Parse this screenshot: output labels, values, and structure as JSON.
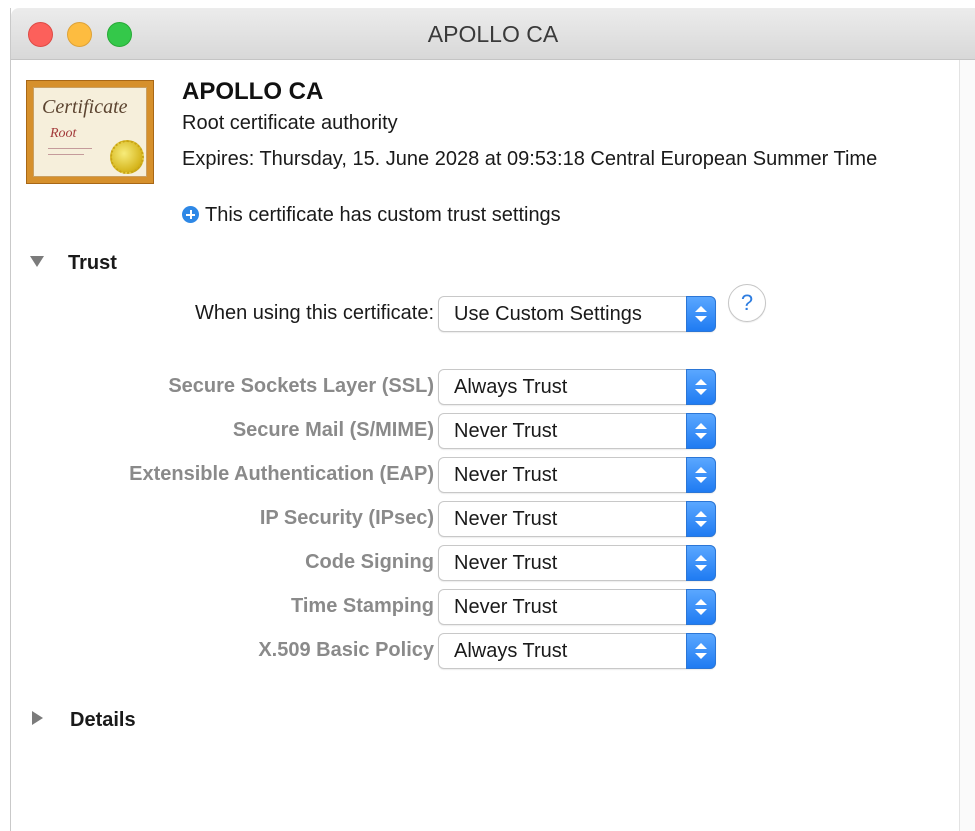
{
  "window": {
    "title": "APOLLO CA"
  },
  "certificate": {
    "icon": "certificate-icon",
    "icon_script": "Certificate",
    "icon_root": "Root",
    "name": "APOLLO CA",
    "kind": "Root certificate authority",
    "expires": "Expires: Thursday, 15. June 2028 at 09:53:18 Central European Summer Time",
    "custom_note": "This certificate has custom trust settings"
  },
  "trust": {
    "section_label": "Trust",
    "expanded": true,
    "when_using_label": "When using this certificate:",
    "when_using_value": "Use Custom Settings",
    "help_label": "?",
    "rows": [
      {
        "label": "Secure Sockets Layer (SSL)",
        "value": "Always Trust"
      },
      {
        "label": "Secure Mail (S/MIME)",
        "value": "Never Trust"
      },
      {
        "label": "Extensible Authentication (EAP)",
        "value": "Never Trust"
      },
      {
        "label": "IP Security (IPsec)",
        "value": "Never Trust"
      },
      {
        "label": "Code Signing",
        "value": "Never Trust"
      },
      {
        "label": "Time Stamping",
        "value": "Never Trust"
      },
      {
        "label": "X.509 Basic Policy",
        "value": "Always Trust"
      }
    ]
  },
  "details": {
    "section_label": "Details",
    "expanded": false
  },
  "colors": {
    "accent": "#1f7bf2",
    "close": "#fc605b",
    "minimize": "#fdbc40",
    "zoom": "#34c84a"
  }
}
